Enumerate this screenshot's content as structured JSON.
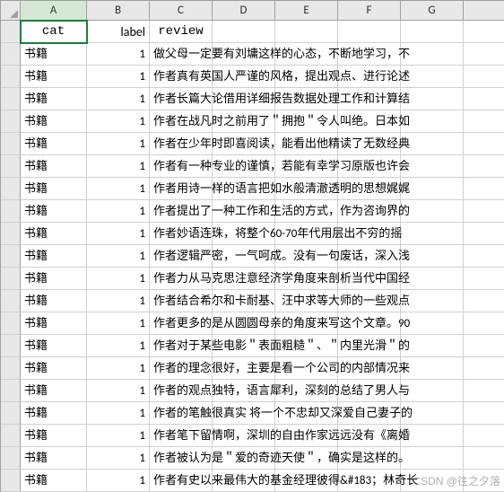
{
  "columns": [
    "A",
    "B",
    "C",
    "D",
    "E",
    "F",
    "G"
  ],
  "headers": {
    "cat": "cat",
    "label": "label",
    "review": "review"
  },
  "rows": [
    {
      "cat": "书籍",
      "label": 1,
      "review": "做父母一定要有刘墉这样的心态，不断地学习，不"
    },
    {
      "cat": "书籍",
      "label": 1,
      "review": "作者真有英国人严谨的风格，提出观点、进行论述"
    },
    {
      "cat": "书籍",
      "label": 1,
      "review": "作者长篇大论借用详细报告数据处理工作和计算结"
    },
    {
      "cat": "书籍",
      "label": 1,
      "review": "作者在战凡时之前用了＂拥抱＂令人叫绝。日本如"
    },
    {
      "cat": "书籍",
      "label": 1,
      "review": "作者在少年时即喜阅读，能看出他精读了无数经典"
    },
    {
      "cat": "书籍",
      "label": 1,
      "review": "作者有一种专业的谨慎，若能有幸学习原版也许会"
    },
    {
      "cat": "书籍",
      "label": 1,
      "review": "作者用诗一样的语言把如水般清澈透明的思想娓娓"
    },
    {
      "cat": "书籍",
      "label": 1,
      "review": "作者提出了一种工作和生活的方式，作为咨询界的"
    },
    {
      "cat": "书籍",
      "label": 1,
      "review": "作者妙语连珠，将整个60-70年代用层出不穷的摇"
    },
    {
      "cat": "书籍",
      "label": 1,
      "review": "作者逻辑严密，一气呵成。没有一句废话，深入浅"
    },
    {
      "cat": "书籍",
      "label": 1,
      "review": "作者力从马克思注意经济学角度来剖析当代中国经"
    },
    {
      "cat": "书籍",
      "label": 1,
      "review": "作者结合希尔和卡耐基、汪中求等大师的一些观点"
    },
    {
      "cat": "书籍",
      "label": 1,
      "review": "作者更多的是从圆圆母亲的角度来写这个文章。90"
    },
    {
      "cat": "书籍",
      "label": 1,
      "review": "作者对于某些电影＂表面粗糙＂、＂内里光滑＂的"
    },
    {
      "cat": "书籍",
      "label": 1,
      "review": "作者的理念很好，主要是看一个公司的内部情况来"
    },
    {
      "cat": "书籍",
      "label": 1,
      "review": "作者的观点独特，语言犀利，深刻的总结了男人与"
    },
    {
      "cat": "书籍",
      "label": 1,
      "review": "作者的笔触很真实 将一个不忠却又深爱自己妻子的"
    },
    {
      "cat": "书籍",
      "label": 1,
      "review": "作者笔下留情啊，深圳的自由作家远远没有《离婚"
    },
    {
      "cat": "书籍",
      "label": 1,
      "review": "作者被认为是＂爱的奇迹天使＂，确实是这样的。"
    },
    {
      "cat": "书籍",
      "label": 1,
      "review": "作者有史以来最伟大的基金经理彼得&#183；林奇长"
    }
  ],
  "selected_cell": "A1",
  "watermark": "CSDN @往之夕落"
}
